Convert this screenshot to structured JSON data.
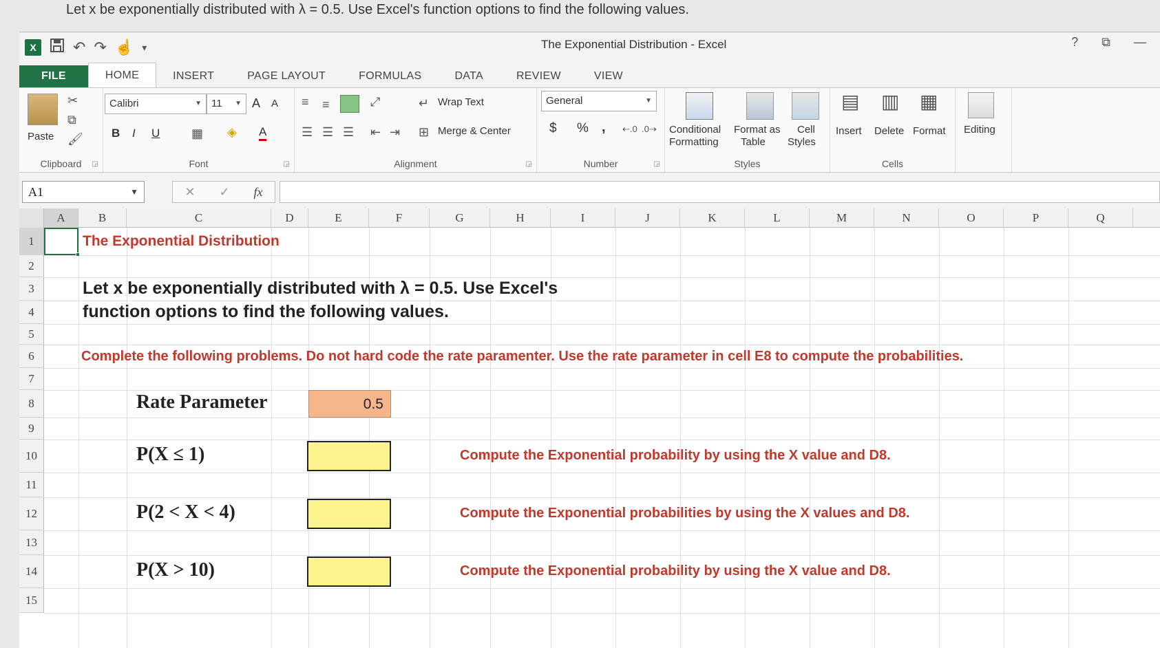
{
  "question_banner": "Let x be exponentially distributed with λ = 0.5.  Use Excel's function options to find the following values.",
  "window": {
    "title": "The Exponential Distribution - Excel",
    "logo": "X",
    "controls": [
      "?",
      "⧉",
      "—"
    ]
  },
  "tabs": [
    "FILE",
    "HOME",
    "INSERT",
    "PAGE LAYOUT",
    "FORMULAS",
    "DATA",
    "REVIEW",
    "VIEW"
  ],
  "active_tab": "HOME",
  "ribbon": {
    "clipboard": {
      "paste": "Paste",
      "label": "Clipboard"
    },
    "font": {
      "name": "Calibri",
      "size": "11",
      "grow": "A",
      "shrink": "A",
      "bold": "B",
      "italic": "I",
      "underline": "U",
      "label": "Font"
    },
    "alignment": {
      "wrap_text": "Wrap Text",
      "merge_center": "Merge & Center",
      "label": "Alignment"
    },
    "number": {
      "format": "General",
      "currency": "$",
      "percent": "%",
      "comma": ",",
      "label": "Number"
    },
    "styles": {
      "conditional_line1": "Conditional",
      "conditional_line2": "Formatting",
      "format_table_line1": "Format as",
      "format_table_line2": "Table",
      "cell_styles_line1": "Cell",
      "cell_styles_line2": "Styles",
      "label": "Styles"
    },
    "cells": {
      "insert": "Insert",
      "delete": "Delete",
      "format": "Format",
      "label": "Cells"
    },
    "editing": {
      "label": "Editing"
    }
  },
  "formula_bar": {
    "name_box": "A1",
    "cancel": "✕",
    "enter": "✓",
    "fx": "fx",
    "value": ""
  },
  "columns": [
    "A",
    "B",
    "C",
    "D",
    "E",
    "F",
    "G",
    "H",
    "I",
    "J",
    "K",
    "L",
    "M",
    "N",
    "O",
    "P",
    "Q"
  ],
  "rows": [
    "1",
    "2",
    "3",
    "4",
    "5",
    "6",
    "7",
    "8",
    "9",
    "10",
    "11",
    "12",
    "13",
    "14",
    "15"
  ],
  "sheet": {
    "title": "The Exponential Distribution",
    "intro_line1": "Let x be exponentially distributed with λ = 0.5.  Use Excel's",
    "intro_line2": "function options to find the following values.",
    "instructions": "Complete the following problems.  Do not hard code the rate paramenter.  Use the rate parameter in cell E8 to compute the probabilities.",
    "rate_label": "Rate Parameter",
    "rate_value": "0.5",
    "p1_label": "P(X ≤ 1)",
    "p1_note": "Compute the Exponential probability by using the X value and D8.",
    "p2_label": "P(2 < X < 4)",
    "p2_note": "Compute the Exponential probabilities by using the X values and D8.",
    "p3_label": "P(X > 10)",
    "p3_note": "Compute the Exponential probability by using the X value and D8."
  },
  "colors": {
    "excel_green": "#217346",
    "rate_fill": "#f6b68c",
    "answer_fill": "#fbf38c",
    "red_text": "#c0392b"
  }
}
